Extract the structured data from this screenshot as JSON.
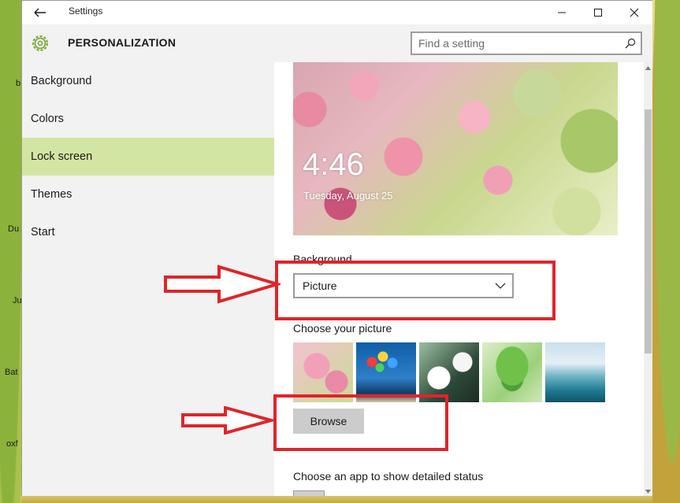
{
  "window": {
    "title": "Settings",
    "section_title": "PERSONALIZATION",
    "search_placeholder": "Find a setting"
  },
  "sidebar": {
    "items": [
      {
        "label": "Background"
      },
      {
        "label": "Colors"
      },
      {
        "label": "Lock screen",
        "active": true
      },
      {
        "label": "Themes"
      },
      {
        "label": "Start"
      }
    ]
  },
  "lock_preview": {
    "time": "4:46",
    "date": "Tuesday, August 25"
  },
  "content": {
    "background_label": "Background",
    "background_value": "Picture",
    "choose_picture_label": "Choose your picture",
    "browse_label": "Browse",
    "app_status_label": "Choose an app to show detailed status"
  },
  "desktop": {
    "labels": [
      "b",
      "Du",
      "Ju",
      "Bat",
      "oxf"
    ]
  },
  "colors": {
    "active_nav": "#d3e5a3",
    "annotation_red": "#e0242a",
    "accent_green": "#6b9a2f"
  }
}
